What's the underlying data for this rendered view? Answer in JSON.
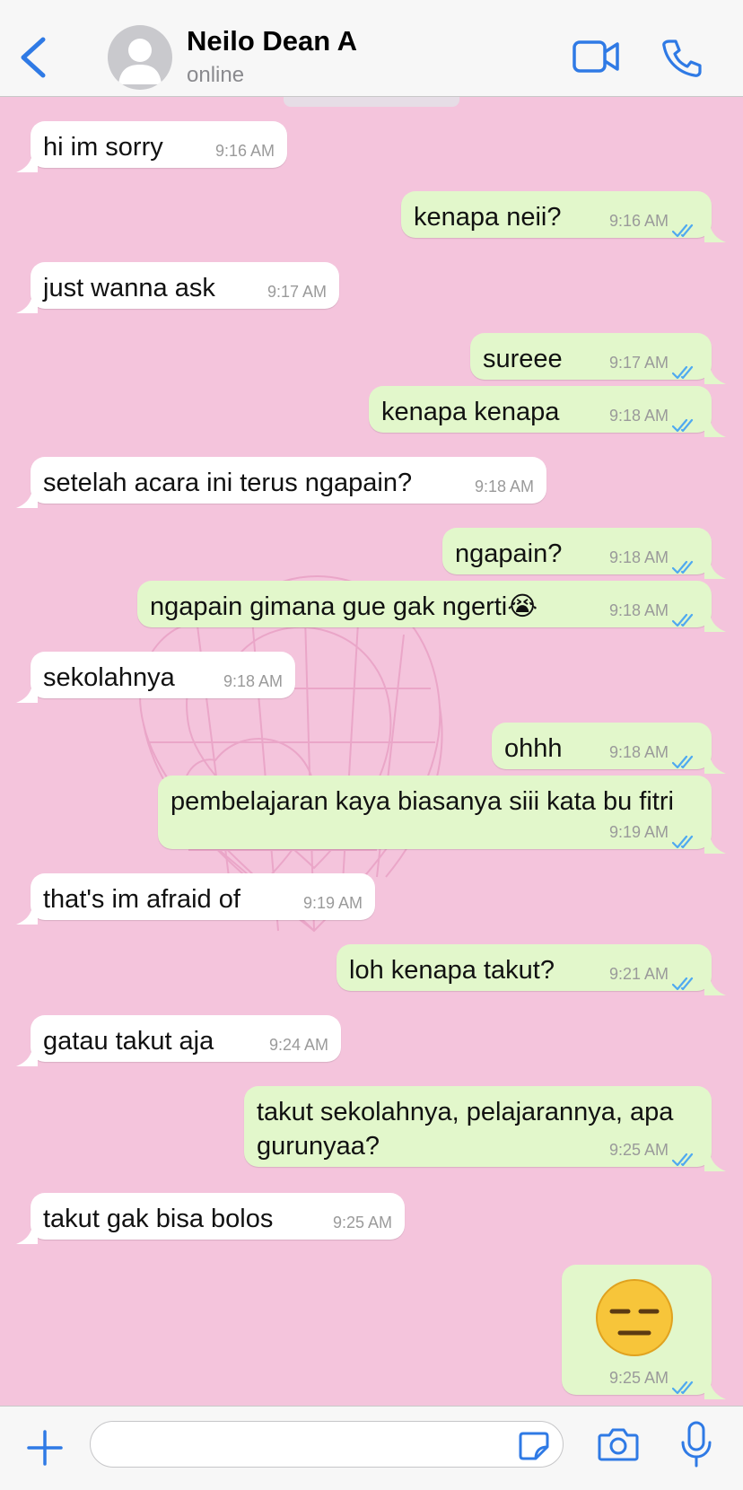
{
  "header": {
    "contact_name": "Neilo Dean A",
    "status": "online",
    "icons": [
      "back-chevron-icon",
      "avatar-placeholder-icon",
      "video-call-icon",
      "phone-call-icon"
    ]
  },
  "messages": [
    {
      "dir": "in",
      "text": "hi im sorry",
      "time": "9:16 AM"
    },
    {
      "dir": "out",
      "text": "kenapa neii?",
      "time": "9:16 AM"
    },
    {
      "dir": "in",
      "text": "just wanna ask",
      "time": "9:17 AM"
    },
    {
      "dir": "out",
      "text": "sureee",
      "time": "9:17 AM"
    },
    {
      "dir": "out",
      "text": "kenapa kenapa",
      "time": "9:18 AM"
    },
    {
      "dir": "in",
      "text": "setelah acara ini terus ngapain?",
      "time": "9:18 AM"
    },
    {
      "dir": "out",
      "text": "ngapain?",
      "time": "9:18 AM"
    },
    {
      "dir": "out",
      "text": "ngapain gimana gue gak ngerti😭",
      "time": "9:18 AM"
    },
    {
      "dir": "in",
      "text": "sekolahnya",
      "time": "9:18 AM"
    },
    {
      "dir": "out",
      "text": "ohhh",
      "time": "9:18 AM"
    },
    {
      "dir": "out",
      "text": "pembelajaran kaya biasanya siii kata bu fitri",
      "time": "9:19 AM"
    },
    {
      "dir": "in",
      "text": "that's im afraid of",
      "time": "9:19 AM"
    },
    {
      "dir": "out",
      "text": "loh kenapa takut?",
      "time": "9:21 AM"
    },
    {
      "dir": "in",
      "text": "gatau takut aja",
      "time": "9:24 AM"
    },
    {
      "dir": "out",
      "text_line1": "takut sekolahnya, pelajarannya, apa",
      "text_line2": "gurunyaa?",
      "time": "9:25 AM"
    },
    {
      "dir": "in",
      "text": "takut gak bisa bolos",
      "time": "9:25 AM"
    },
    {
      "dir": "out",
      "emoji": "expressionless-face-emoji",
      "time": "9:25 AM"
    }
  ],
  "colors": {
    "chat_background": "#f4c4dc",
    "incoming_bubble": "#ffffff",
    "outgoing_bubble": "#e2f7cb",
    "accent_blue": "#2f7ae5",
    "read_ticks": "#4fa9f0"
  },
  "footer": {
    "icons": [
      "plus-icon",
      "sticker-icon",
      "camera-icon",
      "microphone-icon"
    ],
    "input_value": ""
  }
}
